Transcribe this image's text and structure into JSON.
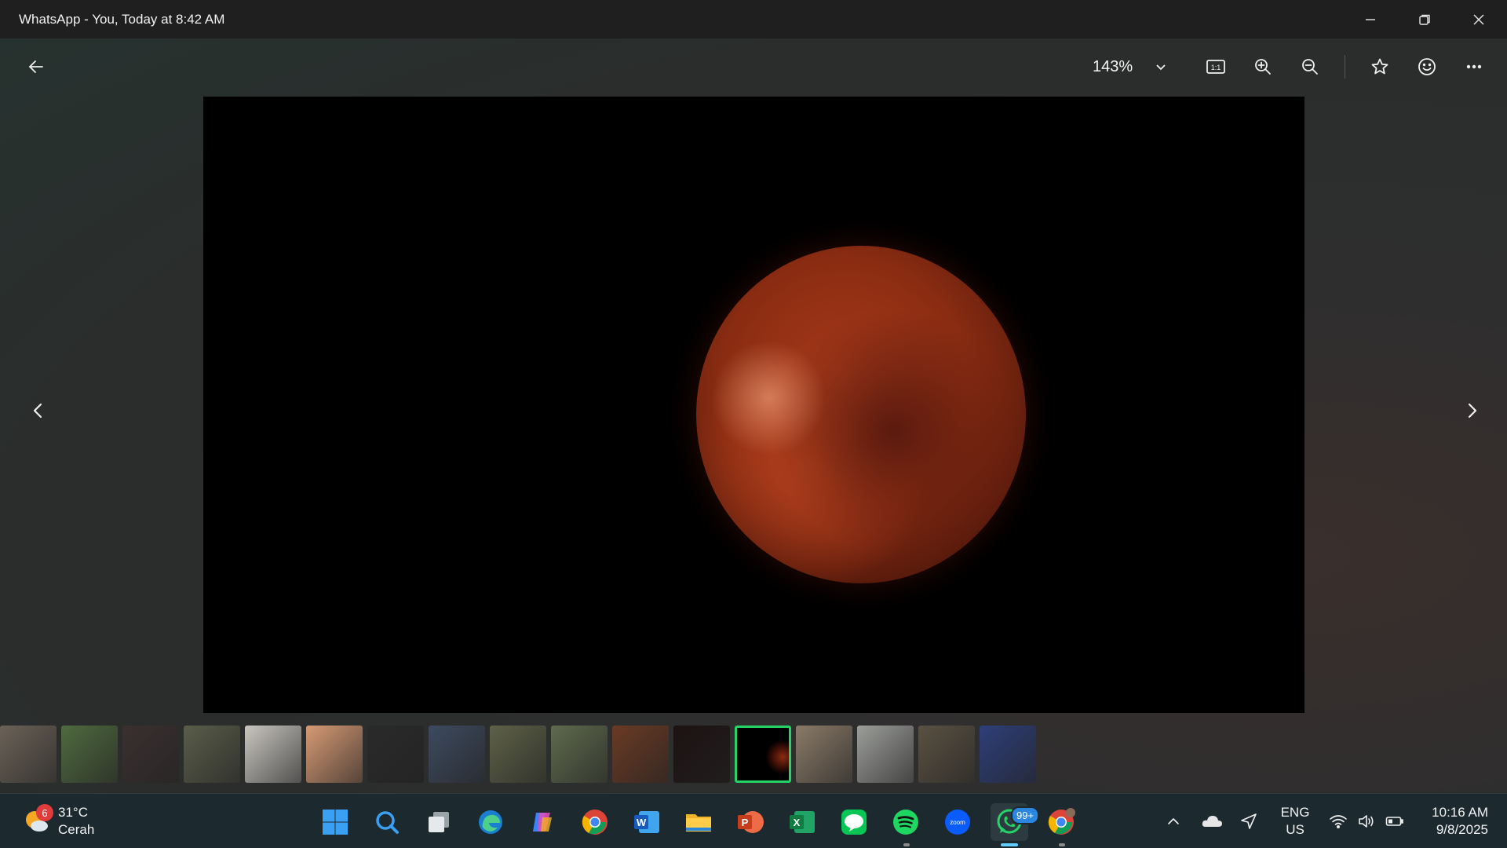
{
  "window": {
    "title": "WhatsApp - You, Today at 8:42 AM",
    "minimize_icon": "minimize-icon",
    "restore_icon": "restore-icon",
    "close_icon": "close-icon"
  },
  "toolbar": {
    "back_icon": "arrow-left-icon",
    "zoom_level": "143%",
    "zoom_dropdown_icon": "chevron-down-icon",
    "actual_size_label": "1:1",
    "zoom_in_icon": "zoom-in-icon",
    "zoom_out_icon": "zoom-out-icon",
    "favorite_icon": "star-icon",
    "react_icon": "smiley-icon",
    "more_icon": "ellipsis-icon"
  },
  "viewer": {
    "prev_icon": "chevron-left-icon",
    "next_icon": "chevron-right-icon",
    "photo": "blood-moon-lunar-eclipse"
  },
  "filmstrip": {
    "thumbnails": [
      {
        "name": "thumb-1",
        "color": "#6b6257"
      },
      {
        "name": "thumb-2",
        "color": "#4f6a3f"
      },
      {
        "name": "thumb-3",
        "color": "#3b3030"
      },
      {
        "name": "thumb-4",
        "color": "#5a5d4a"
      },
      {
        "name": "thumb-5",
        "color": "#c9c6c0"
      },
      {
        "name": "thumb-6",
        "color": "#d69a74"
      },
      {
        "name": "thumb-7",
        "color": "#2a2a2a"
      },
      {
        "name": "thumb-8",
        "color": "#3d4a5e"
      },
      {
        "name": "thumb-9",
        "color": "#5e6148"
      },
      {
        "name": "thumb-10",
        "color": "#5f6a4e"
      },
      {
        "name": "thumb-11",
        "color": "#6a3a24"
      },
      {
        "name": "thumb-12",
        "color": "#1d1212"
      },
      {
        "name": "thumb-13",
        "color": "#000000",
        "selected": true
      },
      {
        "name": "thumb-14",
        "color": "#8a7a68"
      },
      {
        "name": "thumb-15",
        "color": "#9c9e9a"
      },
      {
        "name": "thumb-16",
        "color": "#5a5142"
      },
      {
        "name": "thumb-17",
        "color": "#2e3f7a"
      }
    ],
    "selected_color": "#25d366"
  },
  "taskbar": {
    "weather": {
      "badge": "6",
      "temperature": "31°C",
      "condition": "Cerah",
      "icon": "sun-cloud-icon"
    },
    "apps": [
      {
        "name": "start",
        "icon": "windows-icon"
      },
      {
        "name": "search",
        "icon": "search-icon"
      },
      {
        "name": "task-view",
        "icon": "task-view-icon"
      },
      {
        "name": "edge",
        "icon": "edge-icon"
      },
      {
        "name": "copilot",
        "icon": "copilot-icon"
      },
      {
        "name": "chrome",
        "icon": "chrome-icon"
      },
      {
        "name": "word",
        "icon": "word-icon",
        "letter": "W"
      },
      {
        "name": "file-explorer",
        "icon": "folder-icon"
      },
      {
        "name": "powerpoint",
        "icon": "powerpoint-icon",
        "letter": "P"
      },
      {
        "name": "excel",
        "icon": "excel-icon",
        "letter": "X"
      },
      {
        "name": "line",
        "icon": "line-icon"
      },
      {
        "name": "spotify",
        "icon": "spotify-icon"
      },
      {
        "name": "zoom",
        "icon": "zoom-icon",
        "letter": "zoom"
      },
      {
        "name": "whatsapp",
        "icon": "whatsapp-icon",
        "badge": "99+"
      },
      {
        "name": "chrome-profile",
        "icon": "chrome-icon"
      }
    ],
    "tray": {
      "overflow_icon": "chevron-up-icon",
      "onedrive_icon": "cloud-icon",
      "location_icon": "location-arrow-icon",
      "language_line1": "ENG",
      "language_line2": "US",
      "wifi_icon": "wifi-icon",
      "volume_icon": "speaker-icon",
      "battery_icon": "battery-icon",
      "time": "10:16 AM",
      "date": "9/8/2025"
    }
  }
}
